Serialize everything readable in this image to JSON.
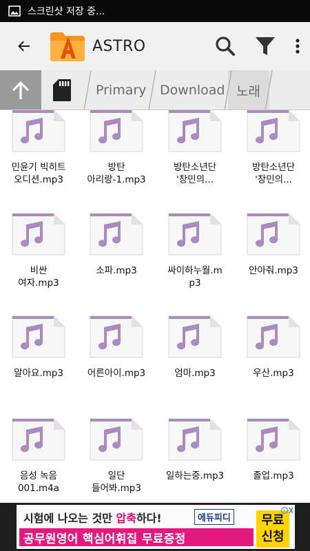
{
  "status_bar": {
    "notification": "스크린샷 저장 중..."
  },
  "toolbar": {
    "title": "ASTRO"
  },
  "breadcrumb": {
    "items": [
      "Primary",
      "Download",
      "노래"
    ]
  },
  "files": [
    {
      "name": "민윤기 빅히트\n오디션.mp3"
    },
    {
      "name": "방탄\n아리랑-1.mp3"
    },
    {
      "name": "방탄소년단\n'창민의..."
    },
    {
      "name": "방탄소년단\n'창민의..."
    },
    {
      "name": "비싼\n여자.mp3"
    },
    {
      "name": "소파.mp3"
    },
    {
      "name": "싸이하누월.m\np3"
    },
    {
      "name": "안아줘.mp3"
    },
    {
      "name": "알아요.mp3"
    },
    {
      "name": "어른아이.mp3"
    },
    {
      "name": "엄마.mp3"
    },
    {
      "name": "우산.mp3"
    },
    {
      "name": "음성 녹음\n001.m4a"
    },
    {
      "name": "일단\n들어봐.mp3"
    },
    {
      "name": "일하는중.mp3"
    },
    {
      "name": "졸업.mp3"
    }
  ],
  "ad": {
    "line1_prefix": "시험에 나오는 것만 ",
    "line1_highlight": "압축",
    "line1_suffix": "하다!",
    "brand": "에듀피디",
    "line2": "공무원영어 핵심어휘집 무료증정",
    "cta_line1": "무료",
    "cta_line2": "신청"
  },
  "colors": {
    "accent": "#f7941d",
    "music_note": "#a98bbf",
    "ad_pink": "#e3197e",
    "ad_yellow": "#ffd500"
  }
}
